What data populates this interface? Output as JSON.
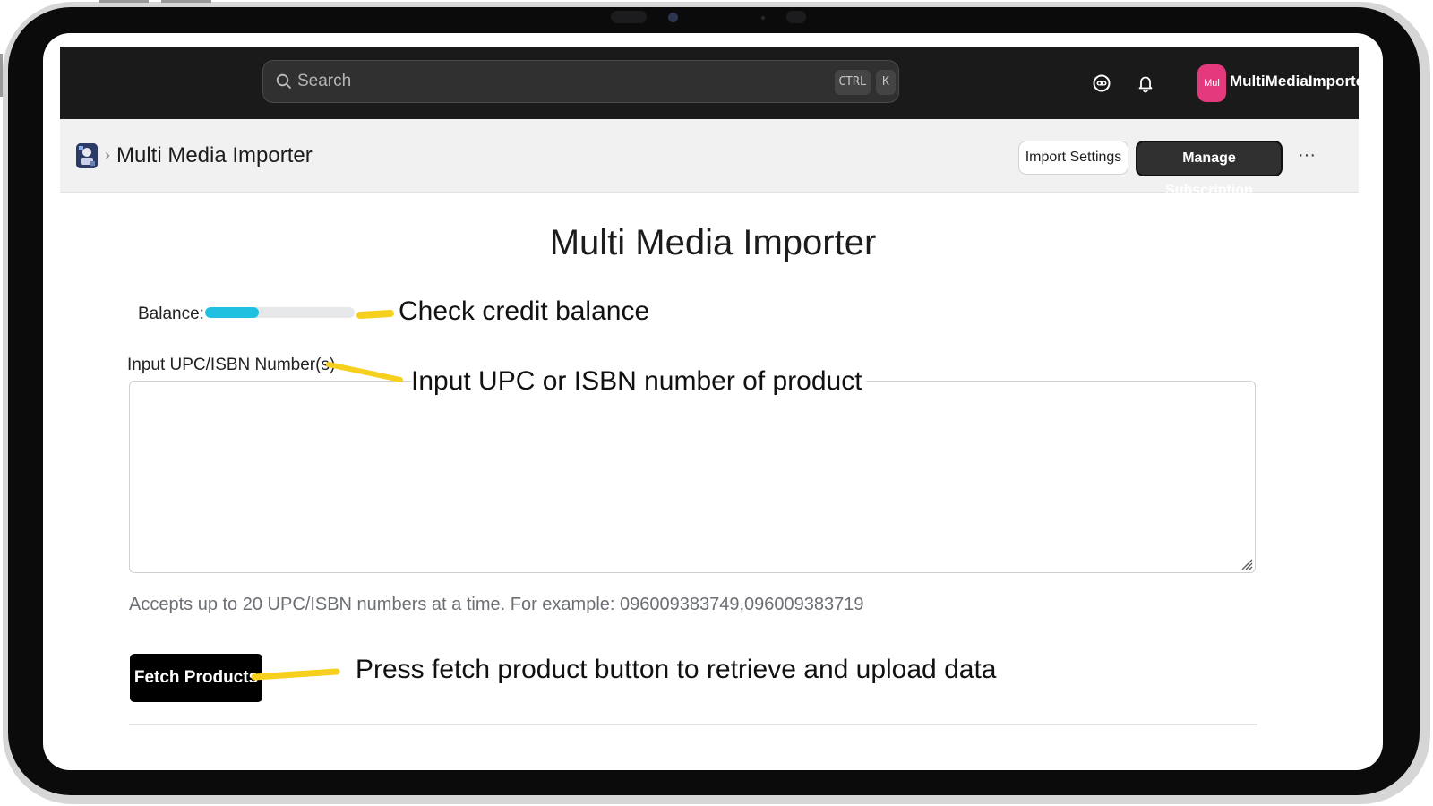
{
  "topbar": {
    "search_placeholder": "Search",
    "shortcut_ctrl": "CTRL",
    "shortcut_k": "K",
    "avatar_initials": "Mul",
    "shop_name": "MultiMediaImporter",
    "avatar_color": "#e5397d",
    "icons": [
      "search-icon",
      "assistant-icon",
      "bell-icon"
    ]
  },
  "page_header": {
    "breadcrumb_title": "Multi Media Importer",
    "import_settings_label": "Import Settings",
    "manage_subscription_label": "Manage Subscription",
    "more_label": "···"
  },
  "main": {
    "title": "Multi Media Importer",
    "balance_label": "Balance:",
    "balance_fraction": 0.36,
    "balance_color": "#1fc0e0",
    "input_label": "Input UPC/ISBN Number(s)",
    "input_value": "",
    "help_text": "Accepts up to 20 UPC/ISBN numbers at a time. For example: 096009383749,096009383719",
    "fetch_label": "Fetch Products"
  },
  "annotations": {
    "balance": "Check credit balance",
    "input": "Input UPC or ISBN number of product",
    "fetch": "Press fetch product button to retrieve and upload data",
    "marker_color": "#f7cf1d"
  }
}
